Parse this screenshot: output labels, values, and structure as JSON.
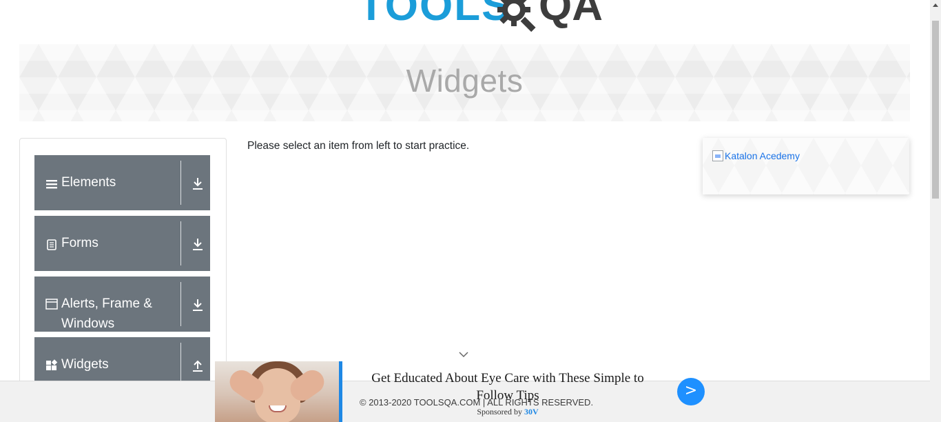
{
  "header": {
    "logo_tools": "TOOLS",
    "logo_qa": "QA"
  },
  "banner": {
    "title": "Widgets"
  },
  "sidebar": {
    "groups": [
      {
        "label": "Elements",
        "icon": "hamburger-icon",
        "arrow": "download-arrow-icon"
      },
      {
        "label": "Forms",
        "icon": "document-icon",
        "arrow": "download-arrow-icon"
      },
      {
        "label_line1": "Alerts, Frame &",
        "label_line2": "Windows",
        "icon": "window-icon",
        "arrow": "download-arrow-icon"
      },
      {
        "label": "Widgets",
        "icon": "widgets-icon",
        "arrow": "upload-arrow-icon"
      }
    ]
  },
  "main": {
    "instruction": "Please select an item from left to start practice."
  },
  "right_ad": {
    "alt_text": "Katalon Acedemy"
  },
  "footer": {
    "copyright": "© 2013-2020 TOOLSQA.COM | ALL RIGHTS RESERVED."
  },
  "overlay_ad": {
    "headline": "Get Educated About Eye Care with These Simple to Follow Tips",
    "sponsored_prefix": "Sponsored by ",
    "sponsor": "30V",
    "next_label": ">",
    "accent_color": "#1e88e5"
  },
  "colors": {
    "sidebar_bg": "#6c757d",
    "logo_blue": "#1b9dd9",
    "logo_dark": "#3d3d3d",
    "next_button": "#1e90ff"
  }
}
